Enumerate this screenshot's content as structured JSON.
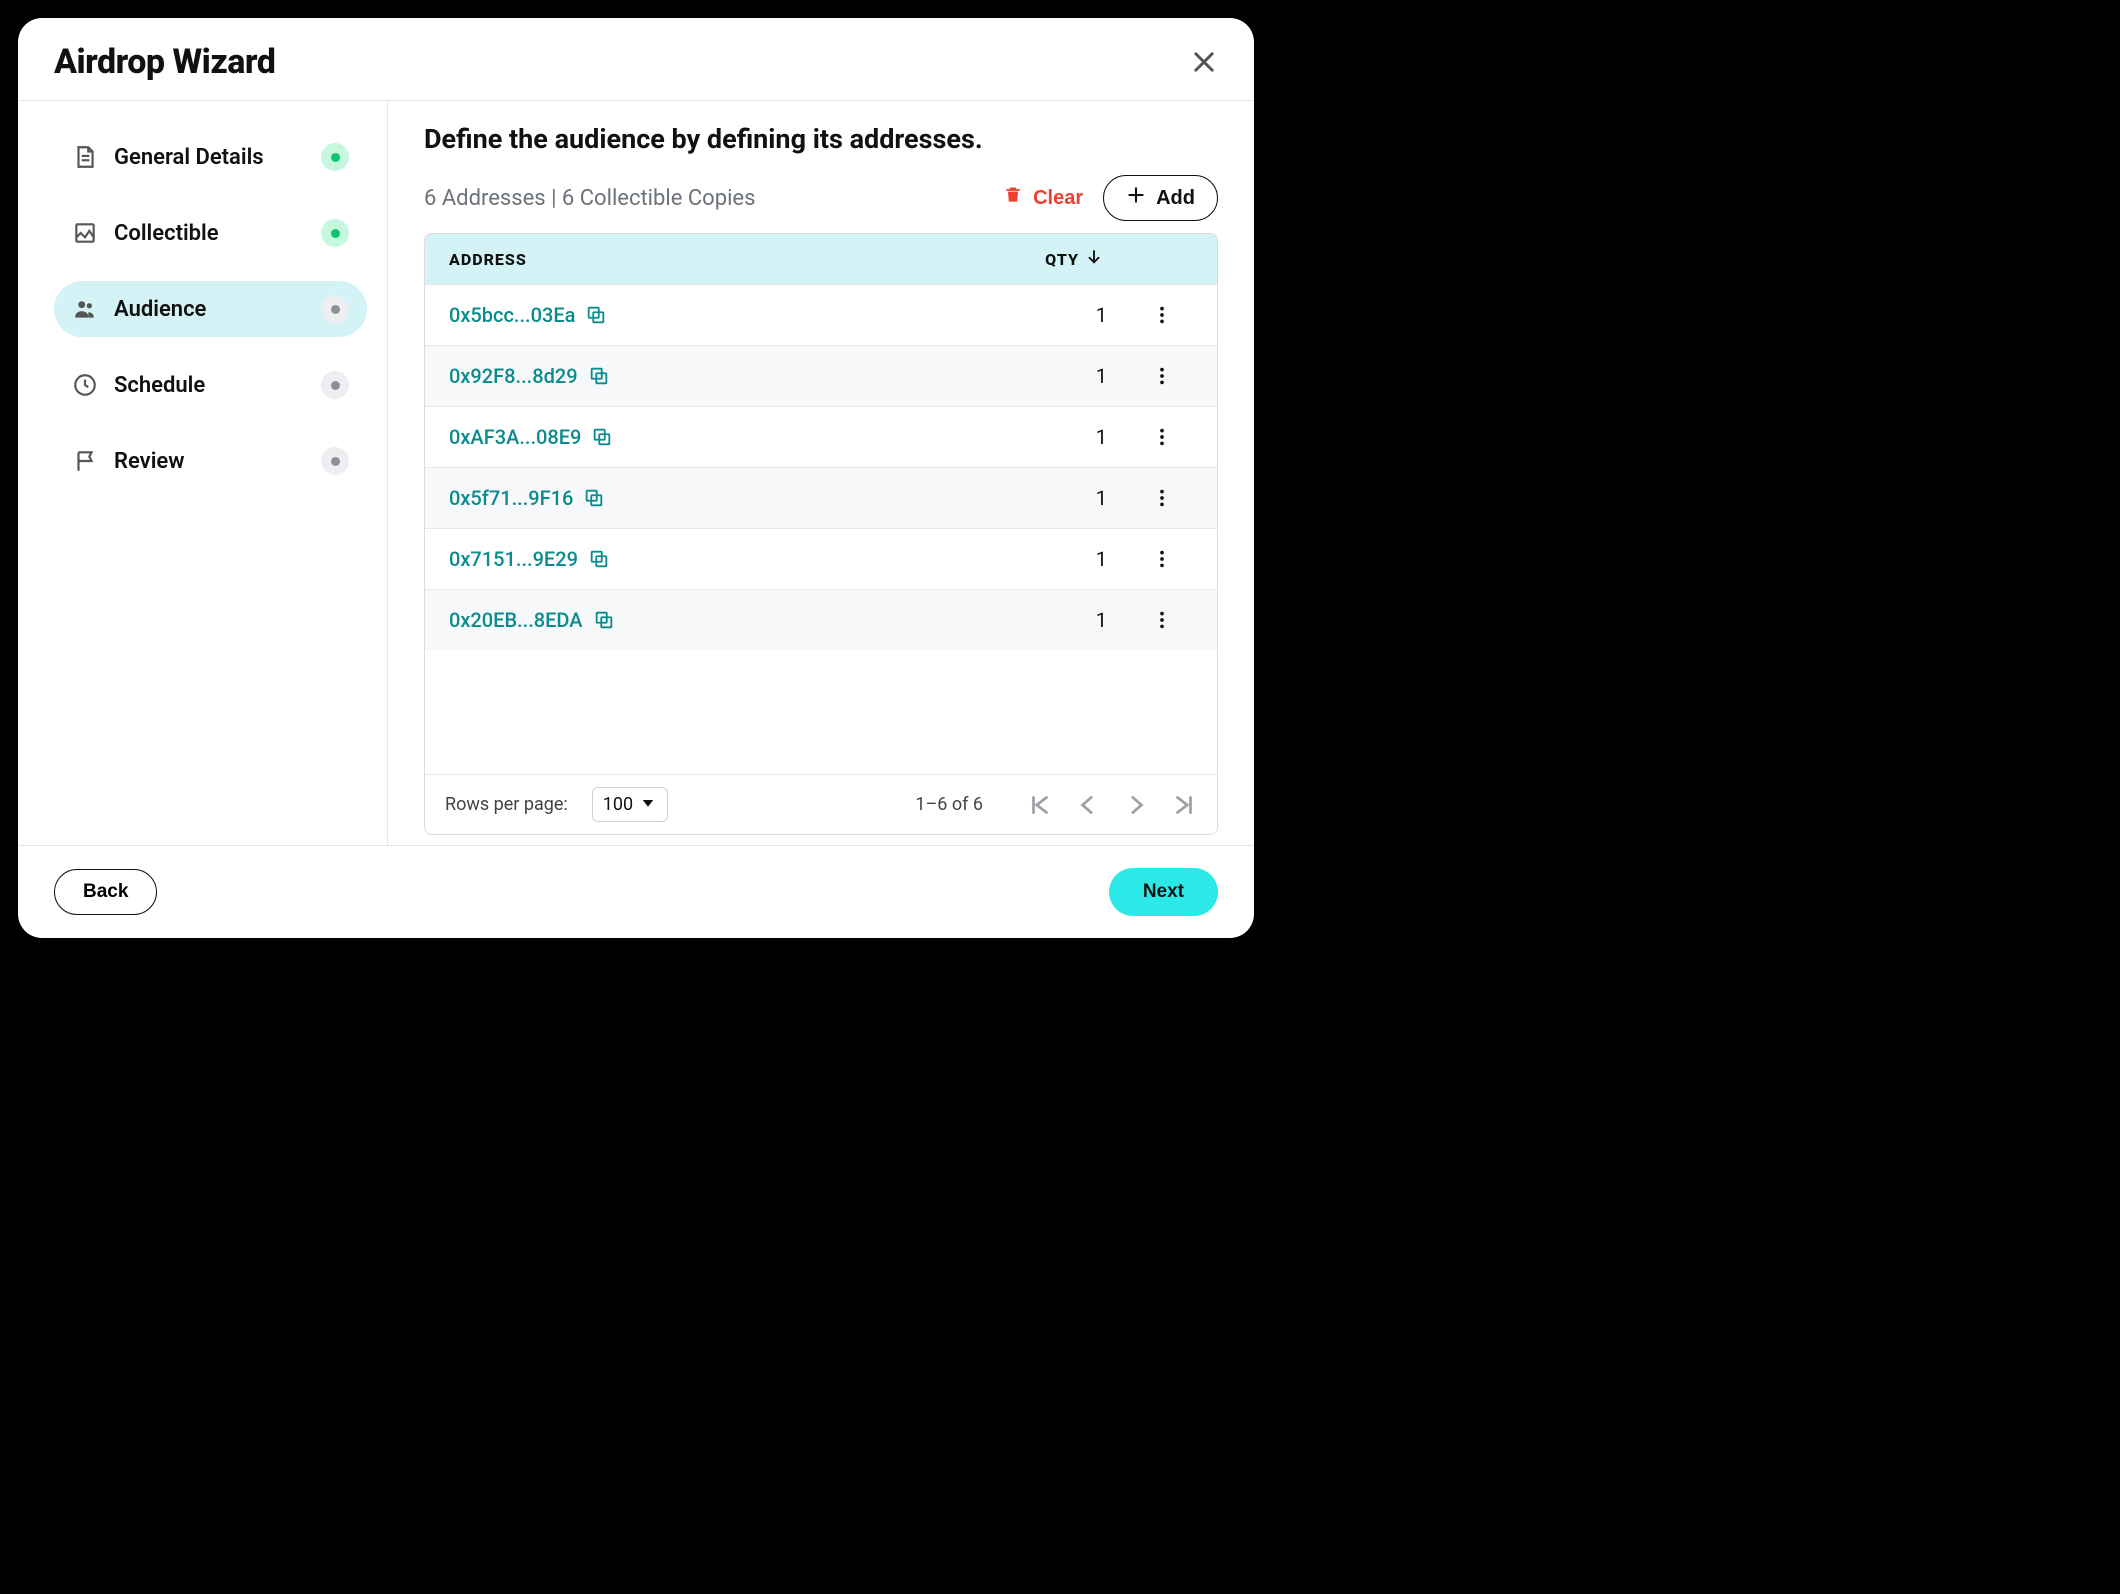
{
  "modal": {
    "title": "Airdrop Wizard"
  },
  "steps": [
    {
      "label": "General Details",
      "status": "done",
      "active": false
    },
    {
      "label": "Collectible",
      "status": "done",
      "active": false
    },
    {
      "label": "Audience",
      "status": "pending",
      "active": true
    },
    {
      "label": "Schedule",
      "status": "pending",
      "active": false
    },
    {
      "label": "Review",
      "status": "pending",
      "active": false
    }
  ],
  "main": {
    "heading": "Define the audience by defining its addresses.",
    "summary": "6 Addresses | 6 Collectible Copies",
    "clear_label": "Clear",
    "add_label": "Add"
  },
  "table": {
    "headers": {
      "address": "ADDRESS",
      "qty": "QTY"
    },
    "rows": [
      {
        "address": "0x5bcc...03Ea",
        "qty": "1"
      },
      {
        "address": "0x92F8...8d29",
        "qty": "1"
      },
      {
        "address": "0xAF3A...08E9",
        "qty": "1"
      },
      {
        "address": "0x5f71...9F16",
        "qty": "1"
      },
      {
        "address": "0x7151...9E29",
        "qty": "1"
      },
      {
        "address": "0x20EB...8EDA",
        "qty": "1"
      }
    ],
    "pagination": {
      "rpp_label": "Rows per page:",
      "rpp_value": "100",
      "range": "1–6 of 6"
    }
  },
  "footer": {
    "back_label": "Back",
    "next_label": "Next"
  },
  "colors": {
    "accent_bg": "#d3f3f6",
    "accent_button": "#2be9e6",
    "link_teal": "#0a8c8e",
    "danger": "#ef3e2d",
    "status_done_bg": "#c6f7df",
    "status_done_dot": "#0cc76a",
    "status_pending_bg": "#eceef1",
    "status_pending_dot": "#8d8f91"
  }
}
